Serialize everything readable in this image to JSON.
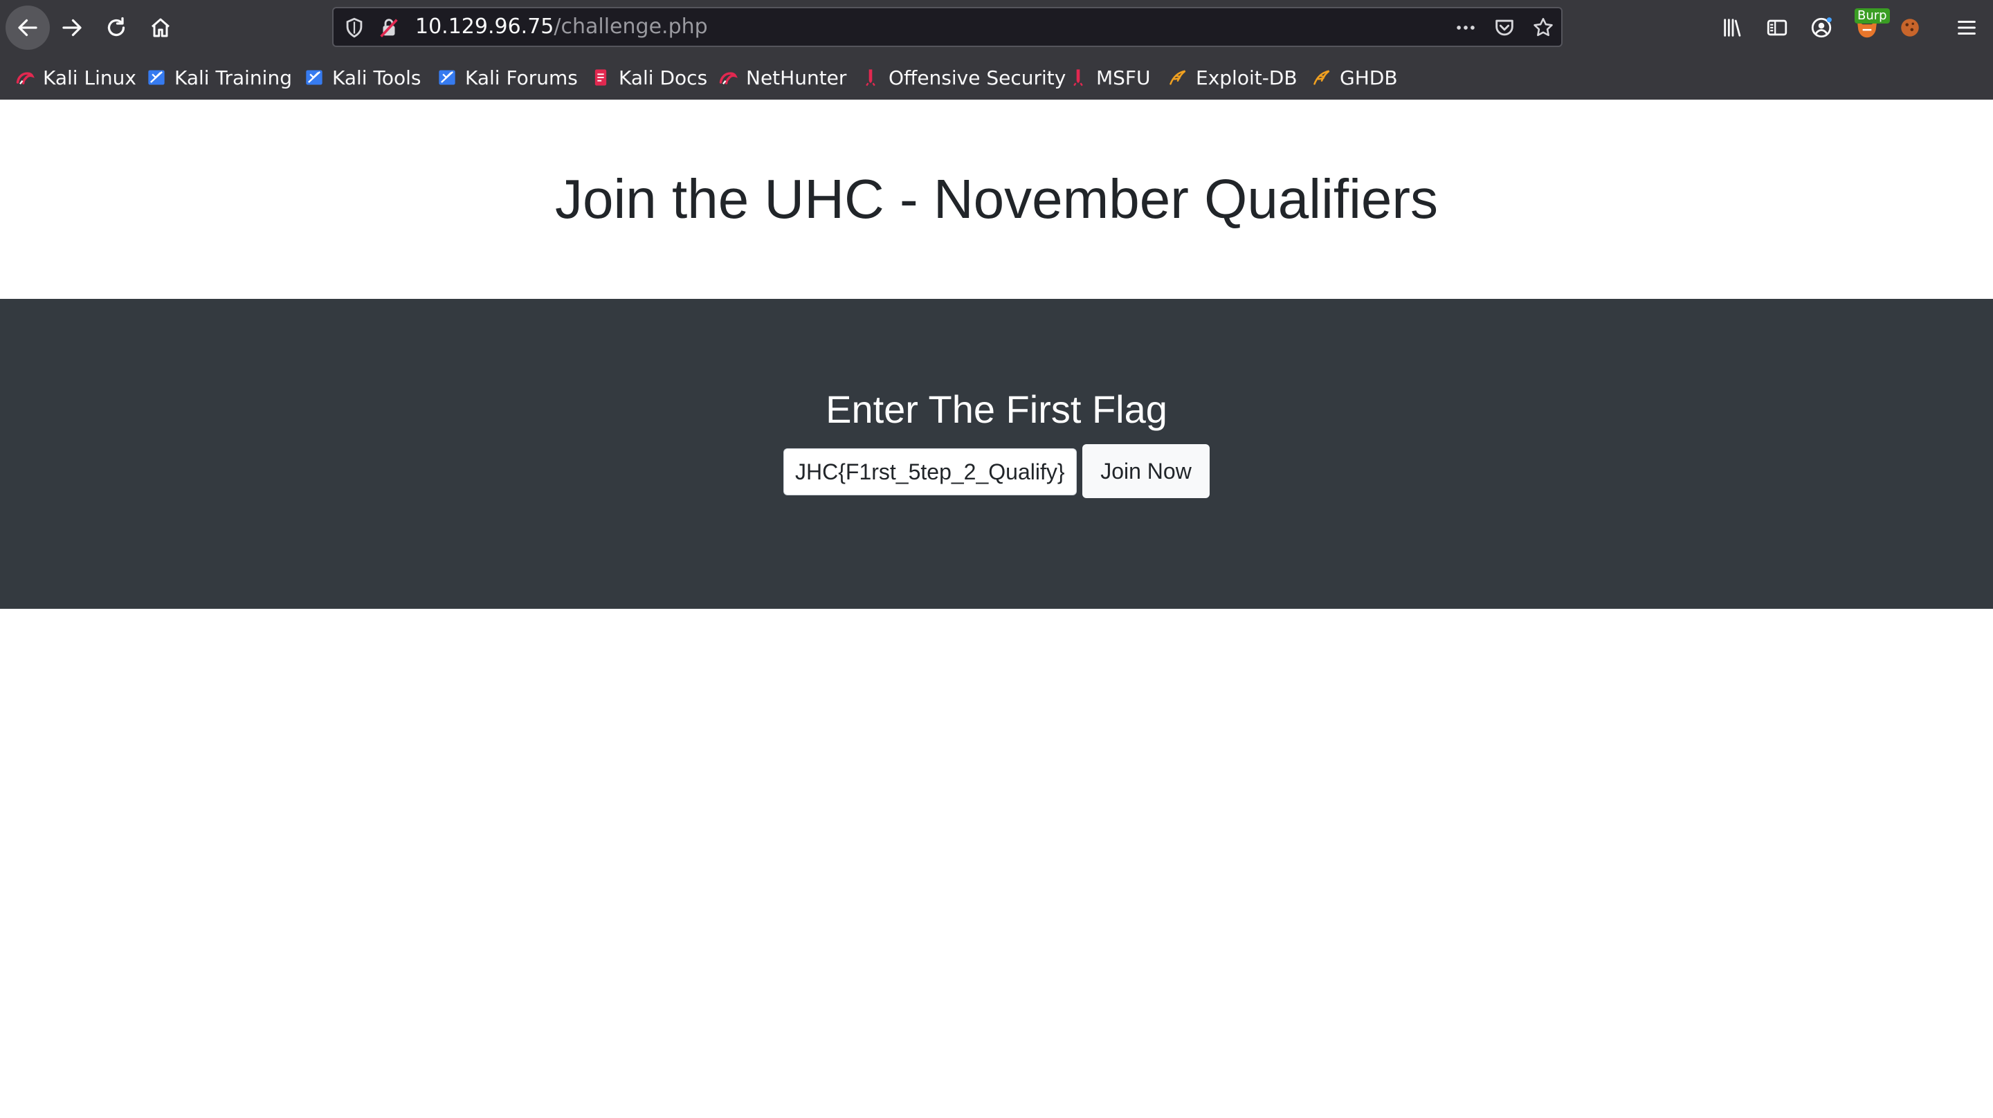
{
  "browser": {
    "url_host": "10.129.96.75",
    "url_path": "/challenge.php",
    "burp_badge": "Burp"
  },
  "bookmarks": [
    {
      "label": "Kali Linux",
      "icon": "kali-dragon-icon"
    },
    {
      "label": "Kali Training",
      "icon": "kali-training-icon"
    },
    {
      "label": "Kali Tools",
      "icon": "kali-tools-icon"
    },
    {
      "label": "Kali Forums",
      "icon": "kali-forums-icon"
    },
    {
      "label": "Kali Docs",
      "icon": "kali-docs-icon"
    },
    {
      "label": "NetHunter",
      "icon": "nethunter-icon"
    },
    {
      "label": "Offensive Security",
      "icon": "offsec-icon"
    },
    {
      "label": "MSFU",
      "icon": "msfu-icon"
    },
    {
      "label": "Exploit-DB",
      "icon": "exploit-db-icon"
    },
    {
      "label": "GHDB",
      "icon": "ghdb-icon"
    }
  ],
  "page": {
    "title": "Join the UHC - November Qualifiers",
    "hero_heading": "Enter The First Flag",
    "flag_input_value": "JHC{F1rst_5tep_2_Qualify}",
    "join_button": "Join Now"
  },
  "colors": {
    "chrome": "#38383d",
    "urlbar": "#1c1b22",
    "hero": "#343a40",
    "title_text": "#212529"
  }
}
